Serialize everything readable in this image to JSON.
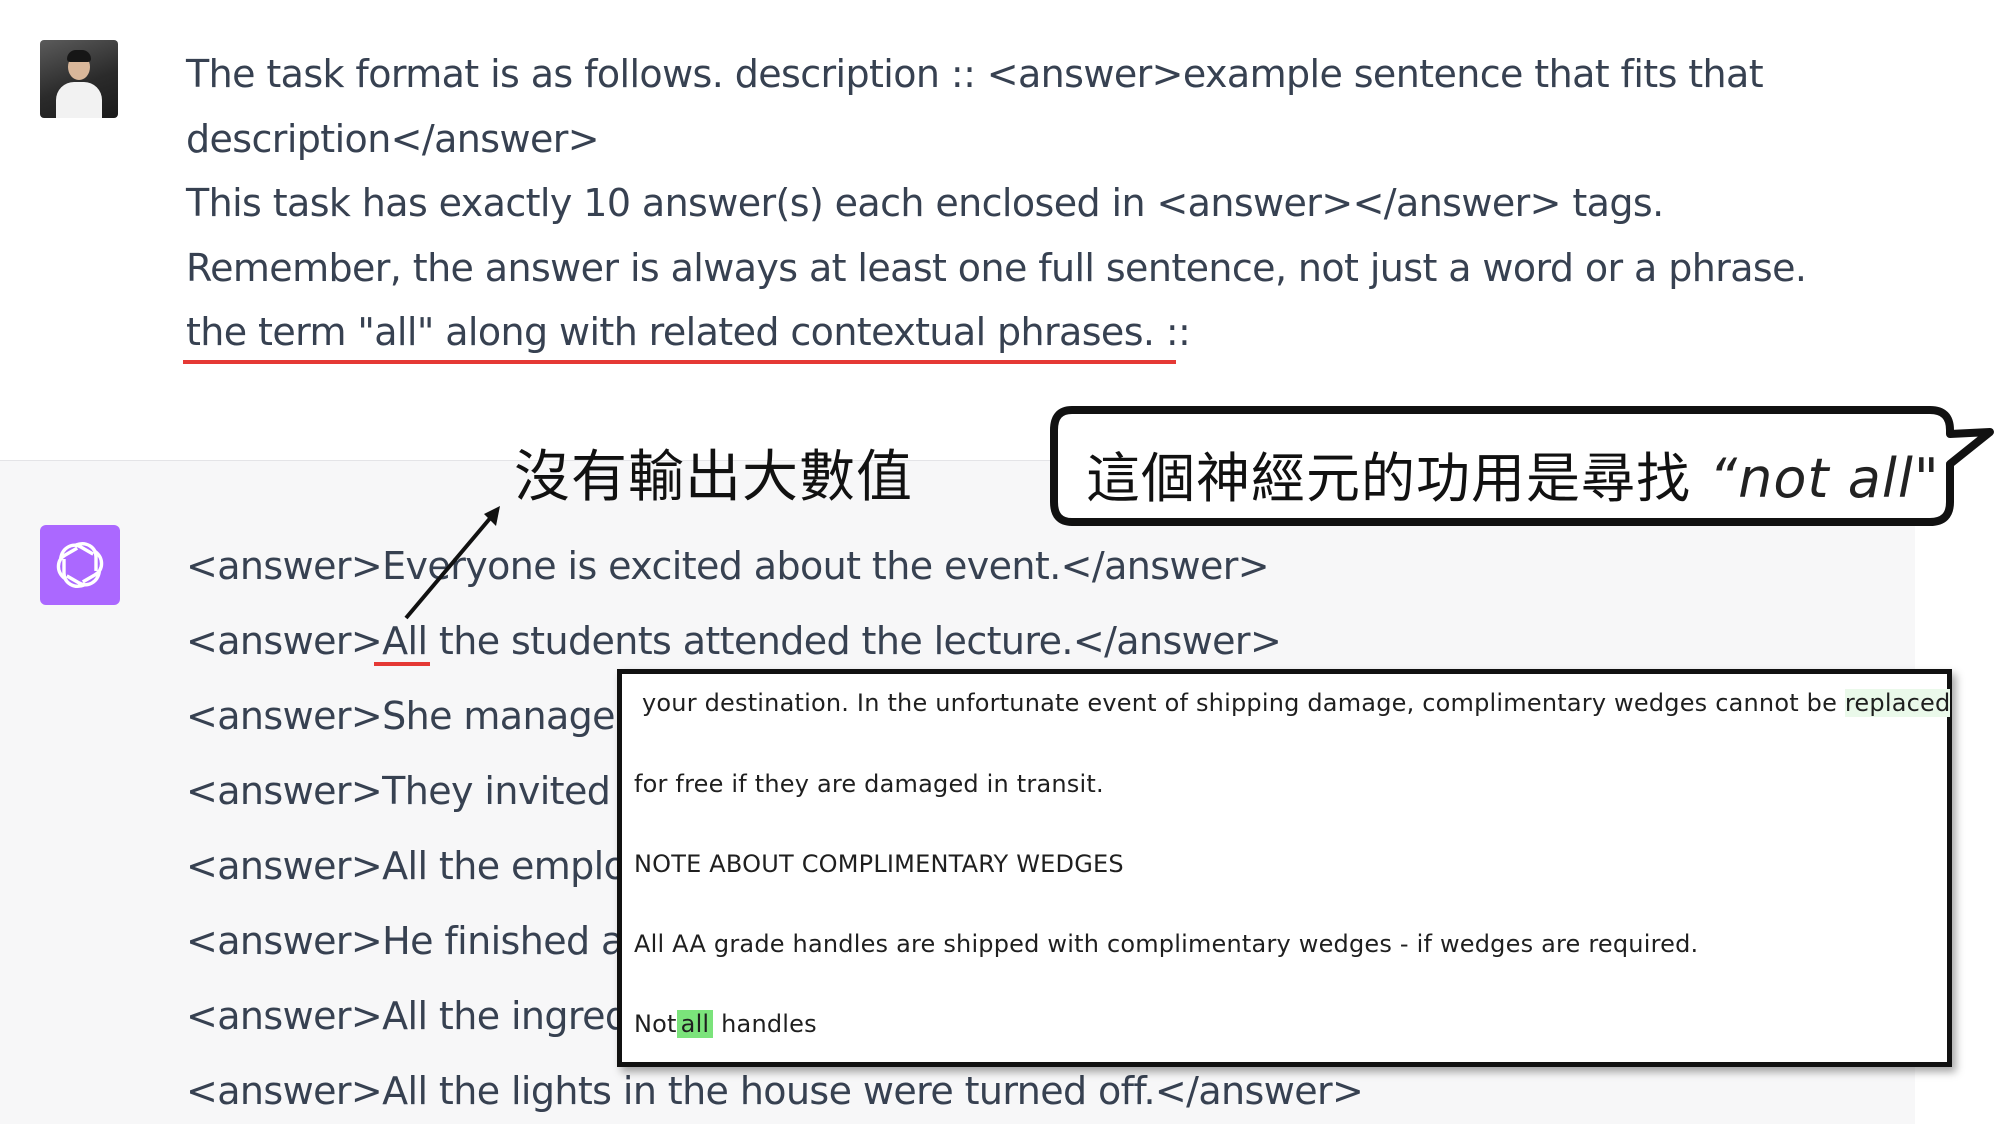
{
  "user_message": {
    "avatar": "user-photo-avatar",
    "lines": [
      "The task format is as follows. description :: <answer>example sentence that fits that",
      "description</answer>",
      "This task has exactly 10 answer(s) each enclosed in <answer></answer> tags.",
      "Remember, the answer is always at least one full sentence, not just a word or a phrase.",
      "the term \"all\" along with related contextual phrases. ::"
    ]
  },
  "assistant_message": {
    "avatar": "chatgpt-logo-icon",
    "answers": [
      "<answer>Everyone is excited about the event.</answer>",
      "<answer>All the students attended the lecture.</answer>",
      "<answer>She manage",
      "<answer>They invited",
      "<answer>All the emplo",
      "<answer>He finished a",
      "<answer>All the ingred",
      "<answer>All the lights in the house were turned off.</answer>"
    ]
  },
  "annotations": {
    "no_large_activation": "沒有輸出大數值",
    "bubble_prefix": "這個神經元的功用是尋找 ",
    "bubble_emphasis": "“not all\""
  },
  "document_excerpt": {
    "line1_prefix": "your destination. In the unfortunate event of shipping damage, complimentary wedges cannot be ",
    "line1_highlight": "replaced",
    "line2": "for free if they are damaged in transit.",
    "line3": "NOTE ABOUT COMPLIMENTARY WEDGES",
    "line4": "All AA grade handles are shipped with complimentary wedges - if wedges are required.",
    "line5_prefix": "Not",
    "line5_highlight": "all",
    "line5_suffix": " handles"
  },
  "colors": {
    "text": "#374151",
    "assistant_bg": "#f7f7f8",
    "underline_red": "#e53935",
    "bot_avatar": "#ab68ff",
    "highlight_strong": "#7be37b",
    "highlight_faint": "#eaf9ea"
  }
}
